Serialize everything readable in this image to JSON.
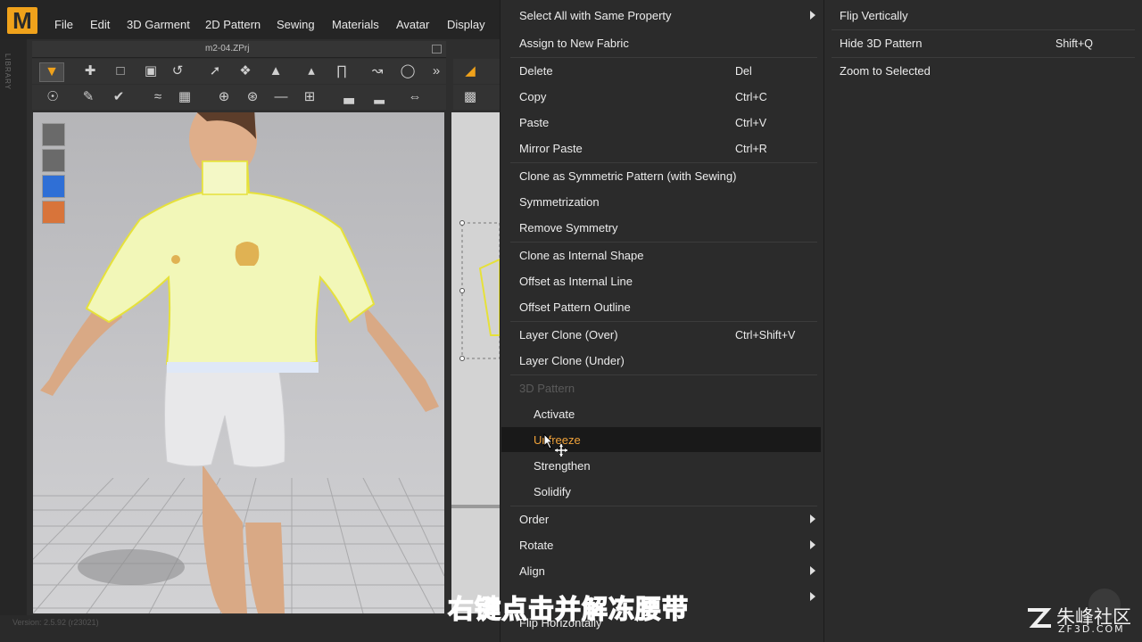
{
  "app": {
    "logo": "M",
    "menus": [
      "File",
      "Edit",
      "3D Garment",
      "2D Pattern",
      "Sewing",
      "Materials",
      "Avatar",
      "Display"
    ],
    "document_title": "m2-04.ZPrj",
    "library_label": "LIBRARY",
    "version": "Version: 2.5.92   (r23021)"
  },
  "context_menu": {
    "items": [
      {
        "label": "Select All with Same Property",
        "submenu": true
      },
      {
        "label": "Assign to New Fabric"
      },
      {
        "label": "Delete",
        "shortcut": "Del"
      },
      {
        "label": "Copy",
        "shortcut": "Ctrl+C"
      },
      {
        "label": "Paste",
        "shortcut": "Ctrl+V"
      },
      {
        "label": "Mirror Paste",
        "shortcut": "Ctrl+R"
      },
      {
        "label": "Clone as Symmetric Pattern (with Sewing)"
      },
      {
        "label": "Symmetrization"
      },
      {
        "label": "Remove Symmetry"
      },
      {
        "label": "Clone as Internal Shape"
      },
      {
        "label": "Offset as Internal Line"
      },
      {
        "label": "Offset Pattern Outline"
      },
      {
        "label": "Layer Clone (Over)",
        "shortcut": "Ctrl+Shift+V"
      },
      {
        "label": "Layer Clone (Under)"
      },
      {
        "label": "3D Pattern",
        "disabled": true
      },
      {
        "label": "Activate"
      },
      {
        "label": "Unfreeze",
        "highlighted": true
      },
      {
        "label": "Strengthen"
      },
      {
        "label": "Solidify"
      },
      {
        "label": "Order",
        "submenu": true
      },
      {
        "label": "Rotate",
        "submenu": true
      },
      {
        "label": "Align",
        "submenu": true
      },
      {
        "label": "Flip Horizontally"
      }
    ]
  },
  "submenu": {
    "items": [
      {
        "label": "Flip Vertically"
      },
      {
        "label": "Hide 3D Pattern",
        "shortcut": "Shift+Q"
      },
      {
        "label": "Zoom to Selected"
      }
    ]
  },
  "caption": "右键点击并解冻腰带",
  "watermark": {
    "name": "朱峰社区",
    "url": "ZF3D.COM"
  },
  "colors": {
    "accent": "#f0a21b",
    "highlight_text": "#f0a23a",
    "caption": "#2a8cf0"
  }
}
